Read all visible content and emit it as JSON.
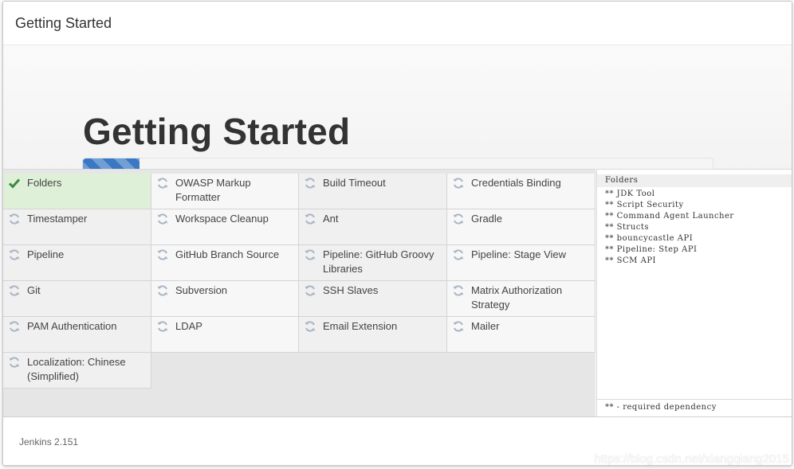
{
  "header": {
    "title": "Getting Started"
  },
  "hero": {
    "title": "Getting Started",
    "progress_fraction": 0.09
  },
  "plugins": [
    {
      "name": "Folders",
      "status": "done"
    },
    {
      "name": "OWASP Markup Formatter",
      "status": "pending"
    },
    {
      "name": "Build Timeout",
      "status": "pending"
    },
    {
      "name": "Credentials Binding",
      "status": "pending"
    },
    {
      "name": "Timestamper",
      "status": "pending"
    },
    {
      "name": "Workspace Cleanup",
      "status": "pending"
    },
    {
      "name": "Ant",
      "status": "pending"
    },
    {
      "name": "Gradle",
      "status": "pending"
    },
    {
      "name": "Pipeline",
      "status": "pending"
    },
    {
      "name": "GitHub Branch Source",
      "status": "pending"
    },
    {
      "name": "Pipeline: GitHub Groovy Libraries",
      "status": "pending"
    },
    {
      "name": "Pipeline: Stage View",
      "status": "pending"
    },
    {
      "name": "Git",
      "status": "pending"
    },
    {
      "name": "Subversion",
      "status": "pending"
    },
    {
      "name": "SSH Slaves",
      "status": "pending"
    },
    {
      "name": "Matrix Authorization Strategy",
      "status": "pending"
    },
    {
      "name": "PAM Authentication",
      "status": "pending"
    },
    {
      "name": "LDAP",
      "status": "pending"
    },
    {
      "name": "Email Extension",
      "status": "pending"
    },
    {
      "name": "Mailer",
      "status": "pending"
    },
    {
      "name": "Localization: Chinese (Simplified)",
      "status": "pending"
    }
  ],
  "log": {
    "current": "Folders",
    "dependencies": [
      "** JDK Tool",
      "** Script Security",
      "** Command Agent Launcher",
      "** Structs",
      "** bouncycastle API",
      "** Pipeline: Step API",
      "** SCM API"
    ],
    "legend": "** - required dependency"
  },
  "footer": {
    "version": "Jenkins 2.151",
    "watermark": "https://blog.csdn.net/xiangqiang2015"
  },
  "colors": {
    "progress": "#3a78c3",
    "done_bg": "#dff0d8",
    "check": "#3c8a3c",
    "pending_icon": "#a9b6c4"
  },
  "icons": {
    "done": "check-icon",
    "pending": "refresh-icon"
  }
}
